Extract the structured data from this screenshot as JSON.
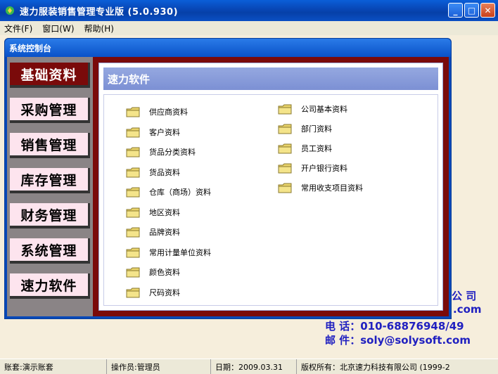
{
  "window": {
    "title": "速力服装销售管理专业版 (5.0.930)"
  },
  "menu": [
    {
      "label": "文件(F)"
    },
    {
      "label": "窗口(W)"
    },
    {
      "label": "帮助(H)"
    }
  ],
  "control": {
    "title": "系统控制台",
    "header": "速力软件",
    "nav": [
      {
        "label": "基础资料"
      },
      {
        "label": "采购管理"
      },
      {
        "label": "销售管理"
      },
      {
        "label": "库存管理"
      },
      {
        "label": "财务管理"
      },
      {
        "label": "系统管理"
      },
      {
        "label": "速力软件"
      }
    ],
    "left_items": [
      {
        "label": "供应商资料"
      },
      {
        "label": "客户资料"
      },
      {
        "label": "货品分类资料"
      },
      {
        "label": "货品资料"
      },
      {
        "label": "仓库（商场）资料"
      },
      {
        "label": "地区资料"
      },
      {
        "label": "品牌资料"
      },
      {
        "label": "常用计量单位资料"
      },
      {
        "label": "颜色资料"
      },
      {
        "label": "尺码资料"
      }
    ],
    "right_items": [
      {
        "label": "公司基本资料"
      },
      {
        "label": "部门资料"
      },
      {
        "label": "员工资料"
      },
      {
        "label": "开户银行资料"
      },
      {
        "label": "常用收支项目资料"
      }
    ]
  },
  "background": {
    "line1": "公 司",
    "line2": ".com",
    "phone": "电 话：010-68876948/49",
    "email": "邮 件：soly@solysoft.com"
  },
  "status": [
    {
      "label": "账套:演示账套"
    },
    {
      "label": "操作员:管理员"
    },
    {
      "label": "日期：2009.03.31"
    },
    {
      "label": "版权所有：北京速力科技有限公司 (1999-2"
    }
  ],
  "colors": {
    "accent": "#0848B8",
    "panel": "#7A0A0A",
    "nav_bg": "#FDE4EE"
  }
}
